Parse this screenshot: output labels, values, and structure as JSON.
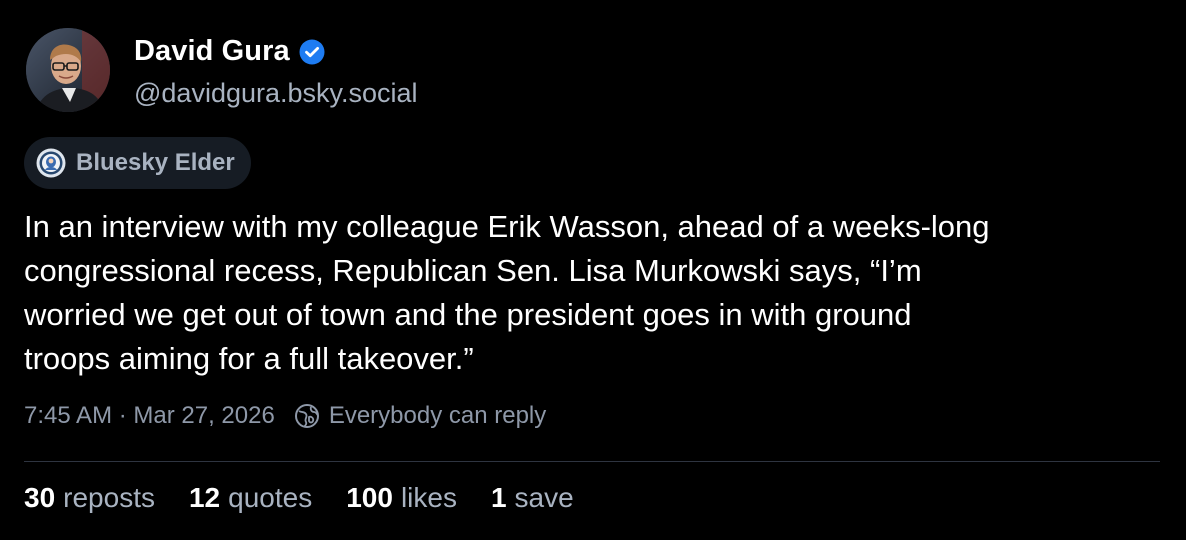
{
  "author": {
    "display_name": "David Gura",
    "handle": "@davidgura.bsky.social",
    "verified_icon": "verified-check-icon",
    "avatar_icon": "avatar-photo"
  },
  "badge": {
    "label": "Bluesky Elder",
    "icon": "bluesky-elder-badge-icon"
  },
  "post": {
    "text_lines": [
      "In an interview with my colleague Erik Wasson, ahead of a weeks-long",
      "congressional recess, Republican Sen. Lisa Murkowski says, “I’m",
      "worried we get out of town and the president goes in with ground",
      "troops aiming for a full takeover.”"
    ]
  },
  "meta": {
    "timestamp": "7:45 AM · Mar 27, 2026",
    "reply_setting": "Everybody can reply",
    "reply_icon": "globe-reply-icon"
  },
  "stats": {
    "reposts_count": "30",
    "reposts_label": "reposts",
    "quotes_count": "12",
    "quotes_label": "quotes",
    "likes_count": "100",
    "likes_label": "likes",
    "saves_count": "1",
    "saves_label": "save"
  },
  "colors": {
    "background": "#000000",
    "text_primary": "#ffffff",
    "text_secondary": "#a9b3c1",
    "verified_blue": "#1e7cf2",
    "badge_background": "#161c24",
    "divider": "#2e3440"
  }
}
